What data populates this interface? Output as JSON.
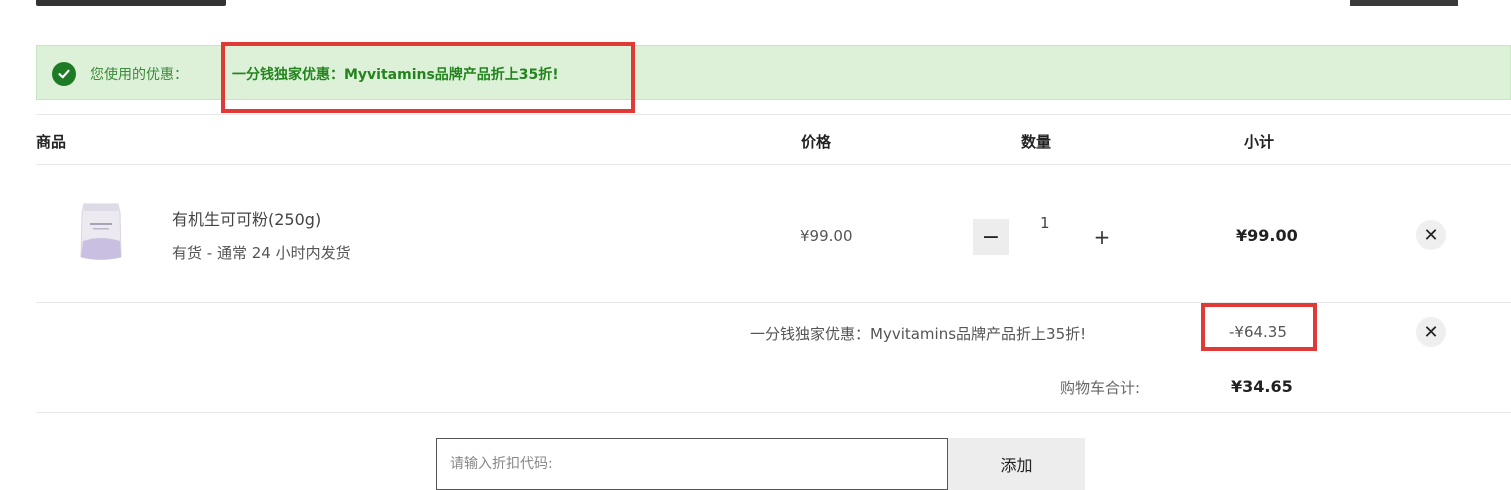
{
  "banner": {
    "label": "您使用的优惠：",
    "coupon_name": "一分钱独家优惠：Myvitamins品牌产品折上35折!"
  },
  "table": {
    "headers": {
      "product": "商品",
      "price": "价格",
      "quantity": "数量",
      "subtotal": "小计"
    }
  },
  "item": {
    "name": "有机生可可粉(250g)",
    "stock": "有货 - 通常 24 小时内发货",
    "price": "¥99.00",
    "quantity": "1",
    "subtotal": "¥99.00",
    "minus_symbol": "−",
    "plus_symbol": "+",
    "remove_symbol": "✕"
  },
  "discount": {
    "label": "一分钱独家优惠：Myvitamins品牌产品折上35折!",
    "amount": "-¥64.35",
    "remove_symbol": "✕"
  },
  "total": {
    "label": "购物车合计:",
    "value": "¥34.65"
  },
  "coupon_input": {
    "placeholder": "请输入折扣代码:",
    "add_label": "添加"
  },
  "colors": {
    "banner_bg": "#ddf1d8",
    "banner_text": "#23841e",
    "check_icon": "#1e7b25",
    "highlight": "#e03a36"
  }
}
